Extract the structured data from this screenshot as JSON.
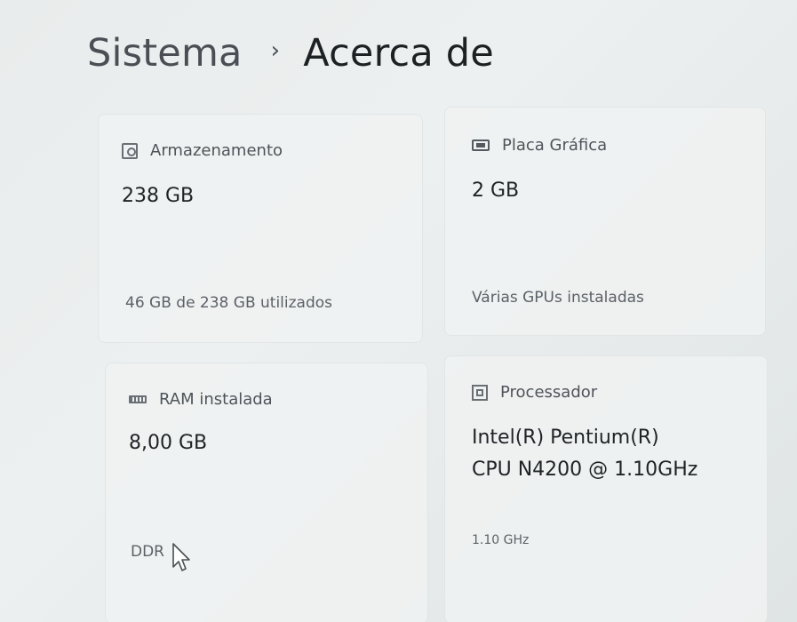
{
  "breadcrumb": {
    "parent": "Sistema",
    "separator": "›",
    "current": "Acerca de"
  },
  "cards": {
    "storage": {
      "icon": "storage-icon",
      "title": "Armazenamento",
      "value": "238 GB",
      "detail": "46 GB de 238 GB utilizados"
    },
    "gpu": {
      "icon": "graphics-card-icon",
      "title": "Placa Gráfica",
      "value": "2 GB",
      "detail": "Várias GPUs instaladas"
    },
    "ram": {
      "icon": "memory-icon",
      "title": "RAM instalada",
      "value": "8,00 GB",
      "detail": "DDR"
    },
    "cpu": {
      "icon": "processor-icon",
      "title": "Processador",
      "value_line1": "Intel(R) Pentium(R)",
      "value_line2": "CPU N4200 @ 1.10GHz",
      "detail": "1.10 GHz"
    }
  }
}
